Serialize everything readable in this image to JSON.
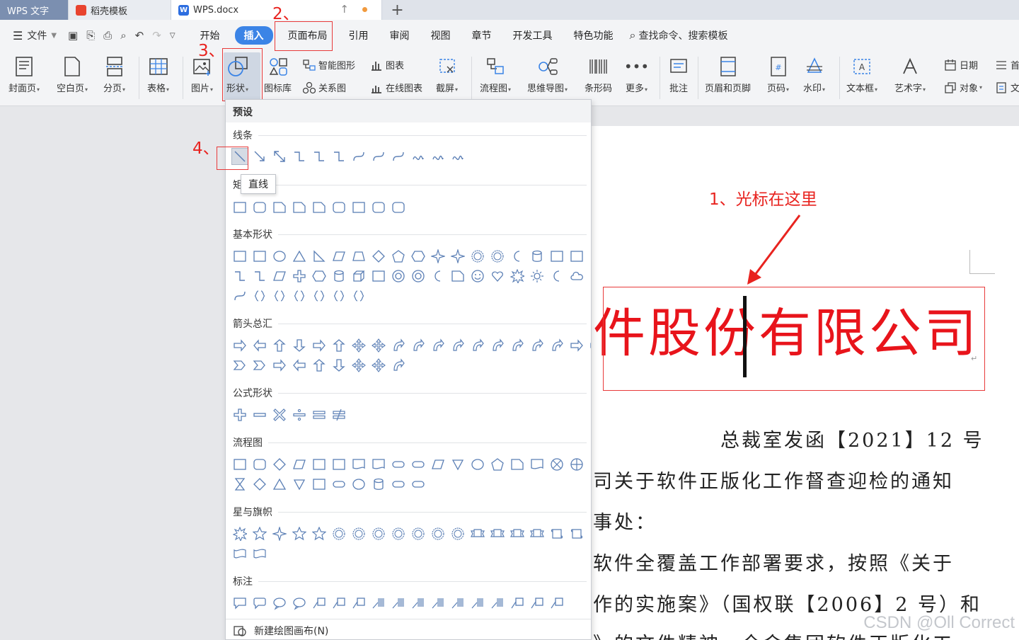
{
  "tabs": [
    {
      "label": "WPS 文字"
    },
    {
      "label": "稻壳模板"
    },
    {
      "label": "WPS.docx"
    }
  ],
  "menu": {
    "file_label": "文件",
    "items": [
      "开始",
      "插入",
      "页面布局",
      "引用",
      "审阅",
      "视图",
      "章节",
      "开发工具",
      "特色功能"
    ],
    "search_label": "查找命令、搜索模板"
  },
  "ribbon": {
    "cover": "封面页",
    "blank": "空白页",
    "break": "分页",
    "table": "表格",
    "picture": "图片",
    "shape": "形状",
    "iconlib": "图标库",
    "smartart": "智能图形",
    "chart": "图表",
    "relation": "关系图",
    "onlinechart": "在线图表",
    "screenshot": "截屏",
    "flowchart": "流程图",
    "mindmap": "思维导图",
    "barcode": "条形码",
    "more": "更多",
    "comment": "批注",
    "headerfooter": "页眉和页脚",
    "pagenum": "页码",
    "watermark": "水印",
    "textbox": "文本框",
    "wordart": "艺术字",
    "date": "日期",
    "object": "对象",
    "cut1": "首",
    "cut2": "文"
  },
  "dropdown": {
    "header": "预设",
    "sections": {
      "lines": "线条",
      "rect": "矩",
      "basic": "基本形状",
      "arrows": "箭头总汇",
      "formula": "公式形状",
      "flow": "流程图",
      "stars": "星与旗帜",
      "callouts": "标注"
    },
    "tooltip": "直线",
    "footer": "新建绘图画布(N)"
  },
  "annotations": {
    "a1": "1、光标在这里",
    "a2": "2、",
    "a3": "3、",
    "a4": "4、"
  },
  "document": {
    "title": "件股份有限公司文件",
    "line1": "总裁室发函【2021】12 号",
    "line2": "司关于软件正版化工作督查迎检的通知",
    "line3": "事处：",
    "line4": "软件全覆盖工作部署要求，按照《关于",
    "line5": "作的实施案》（国权联【2006】2 号）和",
    "line6": "》的文件精神，全金集团软件正版化工"
  },
  "watermark_text": "CSDN @Oll Correct",
  "colors": {
    "accent": "#3b84e6",
    "annotation": "#e8231f",
    "title_red": "#e8141b"
  }
}
